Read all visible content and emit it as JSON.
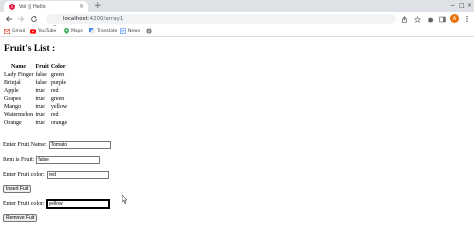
{
  "browser": {
    "tab": {
      "title": "Vol || Hello",
      "close_glyph": "×"
    },
    "new_tab_glyph": "+",
    "window_controls": {
      "minimize": "−",
      "maximize": "□",
      "close": "×"
    },
    "url": {
      "host": "localhost",
      "path": ":4200/array1"
    },
    "avatar_letter": "A",
    "bookmarks": [
      {
        "label": "Gmail",
        "icon": "gmail-icon"
      },
      {
        "label": "YouTube",
        "icon": "youtube-icon"
      },
      {
        "label": "Maps",
        "icon": "maps-icon"
      },
      {
        "label": "Translate",
        "icon": "translate-icon"
      },
      {
        "label": "News",
        "icon": "news-icon"
      },
      {
        "label": "",
        "icon": "globe-icon"
      }
    ]
  },
  "page": {
    "title": "Fruit's List :",
    "table": {
      "headers": [
        "Name",
        "Fruit",
        "Color"
      ],
      "rows": [
        [
          "Lady Finger",
          "false",
          "green"
        ],
        [
          "Brinjal",
          "false",
          "purple"
        ],
        [
          "Apple",
          "true",
          "red"
        ],
        [
          "Grapes",
          "true",
          "green"
        ],
        [
          "Mango",
          "true",
          "yellow"
        ],
        [
          "Watermelon",
          "true",
          "red"
        ],
        [
          "Orange",
          "true",
          "orange"
        ]
      ]
    },
    "form": {
      "name_label": "Enter Fruit Name:",
      "name_value": "Tomato",
      "isfruit_label": "Item is Fruit:",
      "isfruit_value": "false",
      "color_label": "Enter Fruit color:",
      "color_value": "red",
      "insert_button": "Insert Fuit",
      "remove_color_label": "Enter Fruit color:",
      "remove_color_value": "yellow",
      "remove_button": "Remove Fuit"
    }
  },
  "colors": {
    "tabstrip": "#dee1e6",
    "omnibox": "#f1f3f4",
    "avatar": "#e8710a"
  }
}
